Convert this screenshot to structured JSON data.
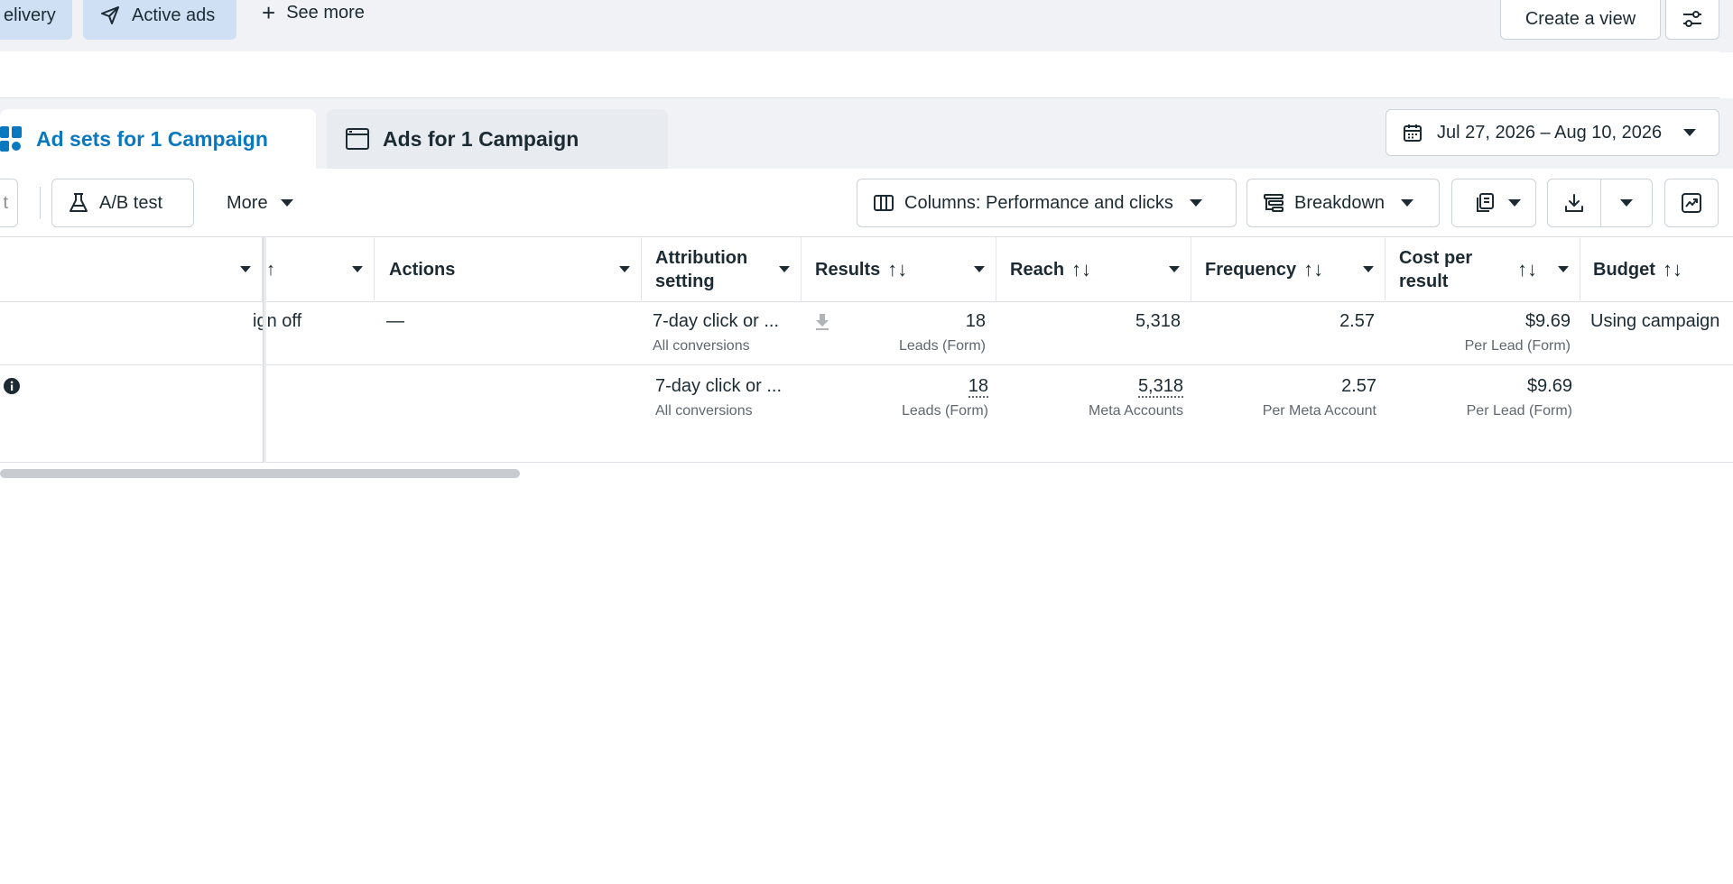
{
  "topbar": {
    "delivery_label": "elivery",
    "active_ads_label": "Active ads",
    "see_more_label": "See more",
    "create_view_label": "Create a view"
  },
  "tabs": {
    "ad_sets_label": "Ad sets for 1 Campaign",
    "ads_label": "Ads for 1 Campaign"
  },
  "date_range": "Jul 27, 2026 – Aug 10, 2026",
  "toolbar": {
    "edit_stub": "t",
    "ab_test_label": "A/B test",
    "more_label": "More",
    "columns_label": "Columns: Performance and clicks",
    "breakdown_label": "Breakdown"
  },
  "table": {
    "headers": {
      "bid_strategy_stub": "↑",
      "actions": "Actions",
      "attribution_line1": "Attribution",
      "attribution_line2": "setting",
      "results": "Results",
      "reach": "Reach",
      "frequency": "Frequency",
      "cost_line1": "Cost per",
      "cost_line2": "result",
      "budget": "Budget",
      "sort_glyph": "↑↓"
    },
    "row1": {
      "bid_text": "ign off",
      "actions": "—",
      "attribution": "7-day click or ...",
      "attribution_sub": "All conversions",
      "results": "18",
      "results_sub": "Leads (Form)",
      "reach": "5,318",
      "frequency": "2.57",
      "cost": "$9.69",
      "cost_sub": "Per Lead (Form)",
      "budget": "Using campaign"
    },
    "row2": {
      "attribution": "7-day click or ...",
      "attribution_sub": "All conversions",
      "results": "18",
      "results_sub": "Leads (Form)",
      "reach": "5,318",
      "reach_sub": "Meta Accounts",
      "frequency": "2.57",
      "frequency_sub": "Per Meta Account",
      "cost": "$9.69",
      "cost_sub": "Per Lead (Form)"
    }
  },
  "colors": {
    "accent": "#0a78be",
    "pill_bg": "#cfe0f5"
  }
}
